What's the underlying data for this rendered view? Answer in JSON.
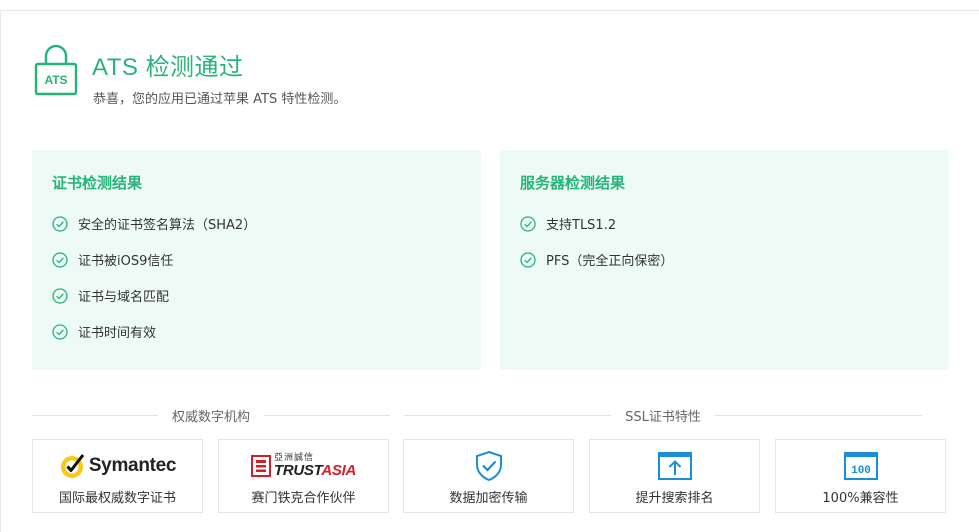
{
  "header": {
    "lock_icon_text": "ATS",
    "title": "ATS 检测通过",
    "subtitle": "恭喜，您的应用已通过苹果 ATS 特性检测。"
  },
  "cert_panel": {
    "title": "证书检测结果",
    "items": [
      {
        "label": "安全的证书签名算法（SHA2）"
      },
      {
        "label": "证书被iOS9信任"
      },
      {
        "label": "证书与域名匹配"
      },
      {
        "label": "证书时间有效"
      }
    ]
  },
  "server_panel": {
    "title": "服务器检测结果",
    "items": [
      {
        "label": "支持TLS1.2"
      },
      {
        "label": "PFS（完全正向保密）"
      }
    ]
  },
  "sections": {
    "authority": "权威数字机构",
    "ssl_features": "SSL证书特性"
  },
  "cards": [
    {
      "logo_text": "Symantec",
      "label": "国际最权威数字证书",
      "icon": "symantec-logo"
    },
    {
      "logo_text_small": "亞洲誠信",
      "logo_text_a": "TRUST",
      "logo_text_b": "ASIA",
      "label": "赛门铁克合作伙伴",
      "icon": "trustasia-logo"
    },
    {
      "label": "数据加密传输",
      "icon": "shield-check-icon"
    },
    {
      "label": "提升搜索排名",
      "icon": "upload-arrow-icon"
    },
    {
      "icon_text": "100",
      "label": "100%兼容性",
      "icon": "compatibility-icon"
    }
  ],
  "colors": {
    "accent": "#27b47a",
    "panel_bg": "#eefaf5",
    "icon_blue": "#1a8fd6",
    "trustasia_red": "#d21f2b",
    "symantec_yellow": "#f8c91b"
  }
}
